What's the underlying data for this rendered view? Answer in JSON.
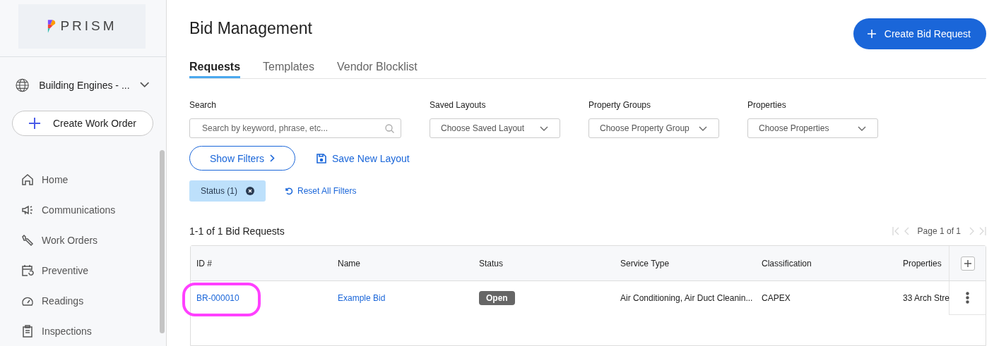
{
  "sidebar": {
    "logo_text": "PRISM",
    "account": "Building Engines - ...",
    "create_button": "Create Work Order",
    "nav": [
      {
        "label": "Home",
        "selected": false
      },
      {
        "label": "Communications",
        "selected": false
      },
      {
        "label": "Work Orders",
        "selected": false
      },
      {
        "label": "Preventive",
        "selected": false
      },
      {
        "label": "Readings",
        "selected": false
      },
      {
        "label": "Inspections",
        "selected": false
      }
    ]
  },
  "page": {
    "title": "Bid Management",
    "primary_button": "Create Bid Request",
    "tabs": [
      {
        "label": "Requests",
        "selected": true
      },
      {
        "label": "Templates",
        "selected": false
      },
      {
        "label": "Vendor Blocklist",
        "selected": false
      }
    ],
    "filters": [
      {
        "kind": "search",
        "label": "Search",
        "placeholder": "Search by keyword, phrase, etc..."
      },
      {
        "kind": "select",
        "label": "Saved Layouts",
        "placeholder": "Choose Saved Layout"
      },
      {
        "kind": "select",
        "label": "Property Groups",
        "placeholder": "Choose Property Group"
      },
      {
        "kind": "select",
        "label": "Properties",
        "placeholder": "Choose Properties"
      }
    ],
    "show_filters": "Show Filters",
    "save_layout": "Save New Layout",
    "chips": [
      {
        "label": "Status (1)"
      }
    ],
    "reset_filters": "Reset All Filters",
    "count": "1-1 of 1 Bid Requests",
    "pagination": {
      "text": "Page 1 of 1",
      "prev_disabled": true,
      "next_disabled": true
    },
    "table": {
      "columns": [
        "ID #",
        "Name",
        "Status",
        "Service Type",
        "Classification",
        "Properties"
      ],
      "rows": [
        {
          "id": "BR-000010",
          "id_highlighted": true,
          "name": "Example Bid",
          "status": "Open",
          "service_type": "Air Conditioning, Air Duct Cleanin...",
          "classification": "CAPEX",
          "properties": "33 Arch Stre"
        }
      ]
    }
  }
}
